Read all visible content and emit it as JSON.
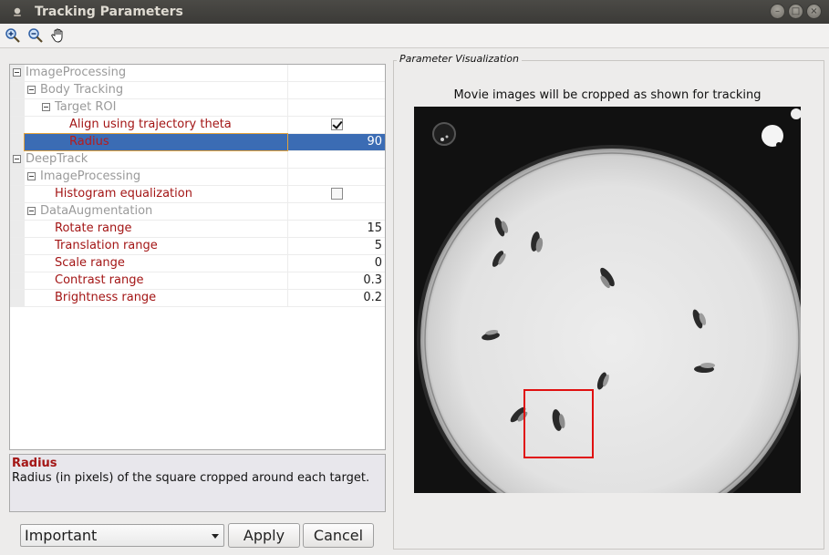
{
  "window": {
    "title": "Tracking Parameters"
  },
  "toolbar": {
    "tools": [
      {
        "name": "zoom-in-icon"
      },
      {
        "name": "zoom-out-icon"
      },
      {
        "name": "pan-hand-icon"
      }
    ]
  },
  "tree": {
    "rows": [
      {
        "label": "ImageProcessing",
        "value": "",
        "kind": "group",
        "level": 0
      },
      {
        "label": "Body Tracking",
        "value": "",
        "kind": "group",
        "level": 1
      },
      {
        "label": "Target ROI",
        "value": "",
        "kind": "group",
        "level": 2
      },
      {
        "label": "Align using trajectory theta",
        "value": "",
        "kind": "checkbox",
        "checked": true,
        "level": 3
      },
      {
        "label": "Radius",
        "value": "90",
        "kind": "number",
        "level": 3,
        "selected": true
      },
      {
        "label": "DeepTrack",
        "value": "",
        "kind": "group",
        "level": 0
      },
      {
        "label": "ImageProcessing",
        "value": "",
        "kind": "group",
        "level": 1
      },
      {
        "label": "Histogram equalization",
        "value": "",
        "kind": "checkbox",
        "checked": false,
        "level": 2
      },
      {
        "label": "DataAugmentation",
        "value": "",
        "kind": "group",
        "level": 1
      },
      {
        "label": "Rotate range",
        "value": "15",
        "kind": "number",
        "level": 2
      },
      {
        "label": "Translation range",
        "value": "5",
        "kind": "number",
        "level": 2
      },
      {
        "label": "Scale range",
        "value": "0",
        "kind": "number",
        "level": 2
      },
      {
        "label": "Contrast range",
        "value": "0.3",
        "kind": "number",
        "level": 2
      },
      {
        "label": "Brightness range",
        "value": "0.2",
        "kind": "number",
        "level": 2
      }
    ]
  },
  "description": {
    "title": "Radius",
    "text": "Radius (in pixels) of the square cropped around each target."
  },
  "controls": {
    "level_select": "Important",
    "apply_label": "Apply",
    "cancel_label": "Cancel"
  },
  "visualization": {
    "legend": "Parameter Visualization",
    "caption": "Movie images will be cropped as shown for tracking",
    "crop_box_color": "#e01010"
  }
}
